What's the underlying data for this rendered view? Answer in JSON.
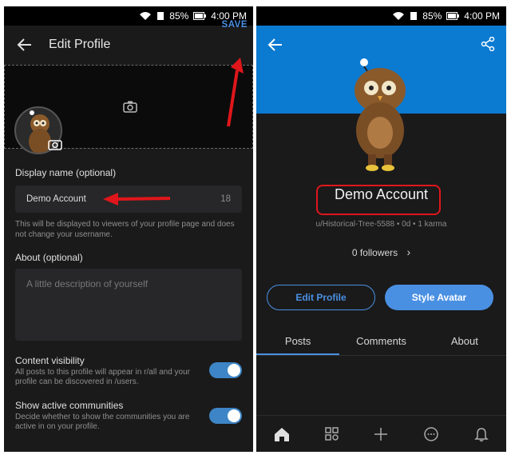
{
  "statusbar": {
    "battery": "85%",
    "time": "4:00 PM"
  },
  "edit_profile": {
    "title": "Edit Profile",
    "save_label": "SAVE",
    "display_name_label": "Display name (optional)",
    "display_name_value": "Demo Account",
    "display_name_counter": "18",
    "display_name_help": "This will be displayed to viewers of your profile page and does not change your username.",
    "about_label": "About (optional)",
    "about_placeholder": "A little description of yourself",
    "content_visibility_title": "Content visibility",
    "content_visibility_desc": "All posts to this profile will appear in r/all and your profile can be discovered in /users.",
    "active_communities_title": "Show active communities",
    "active_communities_desc": "Decide whether to show the communities you are active in on your profile."
  },
  "profile": {
    "display_name": "Demo Account",
    "meta": "u/Historical-Tree-5588 • 0d • 1 karma",
    "followers": "0 followers",
    "edit_button": "Edit Profile",
    "style_button": "Style Avatar",
    "tabs": [
      "Posts",
      "Comments",
      "About"
    ]
  },
  "colors": {
    "accent": "#4a90e2",
    "banner": "#0b7ad1",
    "annotation": "#e0161b"
  }
}
